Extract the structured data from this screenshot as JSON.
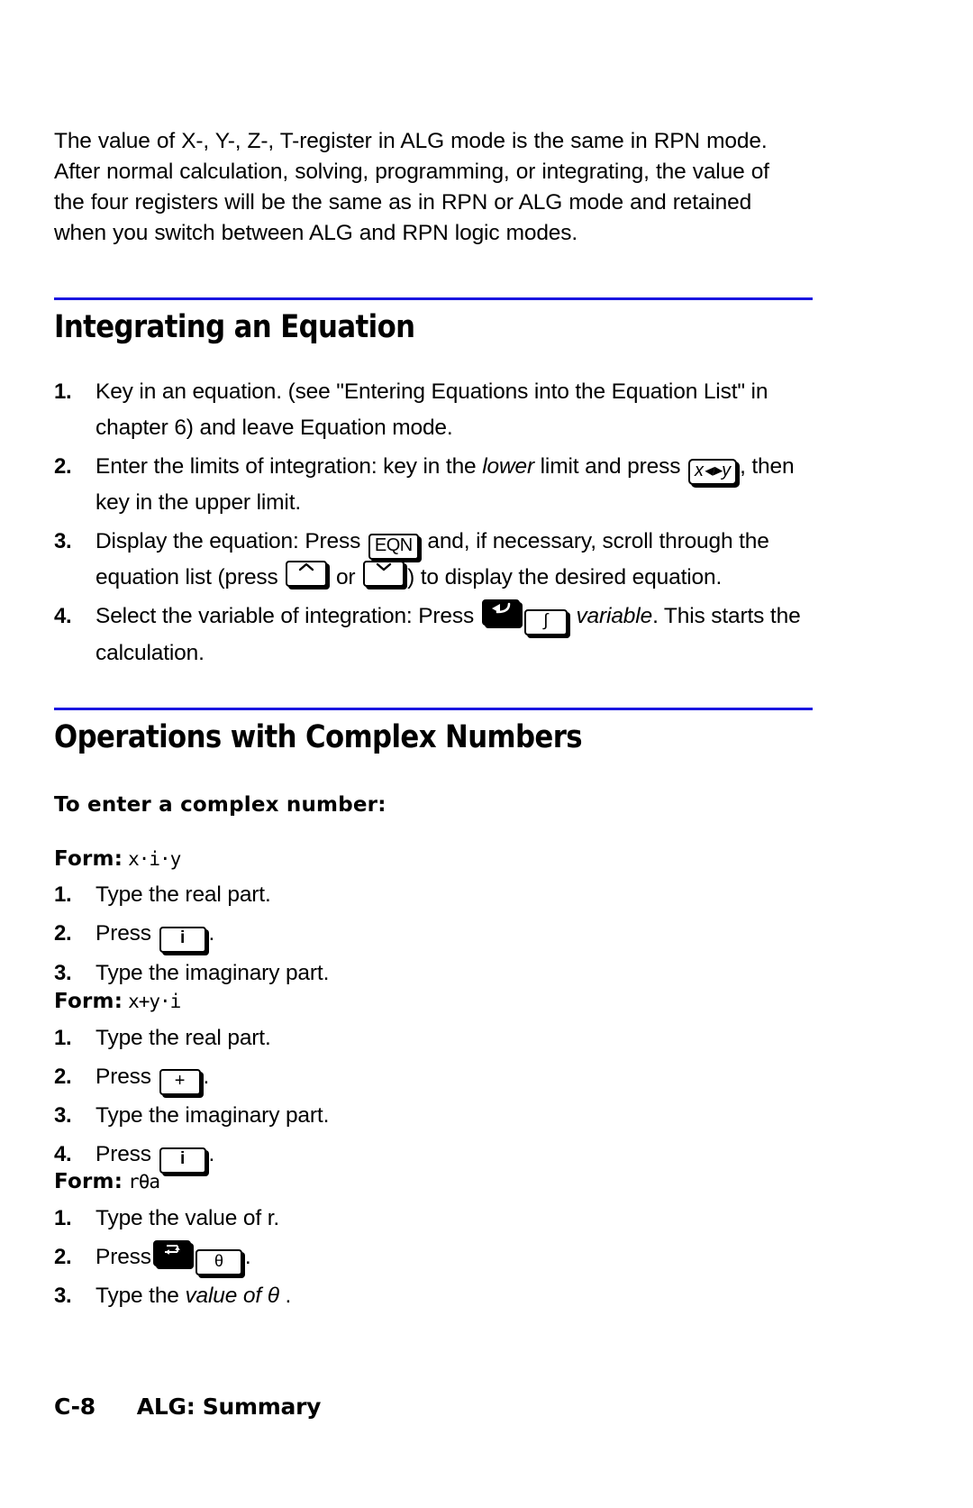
{
  "page": {
    "intro_paragraph": "The value of X-, Y-, Z-, T-register in ALG mode is the same in RPN mode.  After normal calculation, solving, programming, or integrating, the value of the four registers will be the same as in RPN or ALG mode and retained when you switch between ALG and RPN logic modes.",
    "footer": {
      "page_number": "C-8",
      "chapter_title": "ALG: Summary"
    }
  },
  "sections": [
    {
      "title": "Integrating an Equation",
      "steps": [
        {
          "number": "1.",
          "text_before": "Key in an equation. (see \"Entering Equations into the Equation List\" in chapter 6) and leave Equation mode."
        },
        {
          "number": "2.",
          "text_before": "Enter the limits of integration: key in the ",
          "italic_1": "lower",
          "text_mid": " limit and press ",
          "key_1": "x◂▸y",
          "text_after": ", then key in the upper limit."
        },
        {
          "number": "3.",
          "text_before": "Display the equation: Press ",
          "key_1": "EQN",
          "text_mid": " and, if necessary, scroll through the equation list (press ",
          "key_2": "⌃",
          "text_mid2": " or ",
          "key_3": "⌄",
          "text_after": ") to display the desired equation."
        },
        {
          "number": "4.",
          "text_before": "Select the variable of integration: Press ",
          "key_1": "shift-left-arrow",
          "key_2": "∫",
          "text_mid": " ",
          "italic_1": "variable",
          "text_after": ". This starts the calculation."
        }
      ]
    },
    {
      "title": "Operations with Complex Numbers",
      "subhead": "To enter a complex number:",
      "forms": [
        {
          "label": "Form:",
          "expression": "x·i·y",
          "steps": [
            {
              "number": "1.",
              "text_before": "Type the real part."
            },
            {
              "number": "2.",
              "text_before": "Press ",
              "key_1": "i",
              "text_after": "."
            },
            {
              "number": "3.",
              "text_before": "Type the imaginary part."
            }
          ]
        },
        {
          "label": "Form:",
          "expression": "x+y·i",
          "steps": [
            {
              "number": "1.",
              "text_before": "Type the real part."
            },
            {
              "number": "2.",
              "text_before": "Press ",
              "key_1": "+",
              "text_after": "."
            },
            {
              "number": "3.",
              "text_before": "Type the imaginary part."
            },
            {
              "number": "4.",
              "text_before": "Press ",
              "key_1": "i",
              "text_after": "."
            }
          ]
        },
        {
          "label": "Form:",
          "expression": "rθa",
          "steps": [
            {
              "number": "1.",
              "text_before": "Type the value of r."
            },
            {
              "number": "2.",
              "text_before": "Press",
              "key_1": "polar",
              "key_2": "θ",
              "text_after": "."
            },
            {
              "number": "3.",
              "text_before": "Type the ",
              "italic_1": "value of θ",
              "text_after": " ."
            }
          ]
        }
      ]
    }
  ],
  "colors": {
    "rule_blue": "#1a16e0",
    "text_black": "#000000",
    "page_background": "#ffffff"
  }
}
